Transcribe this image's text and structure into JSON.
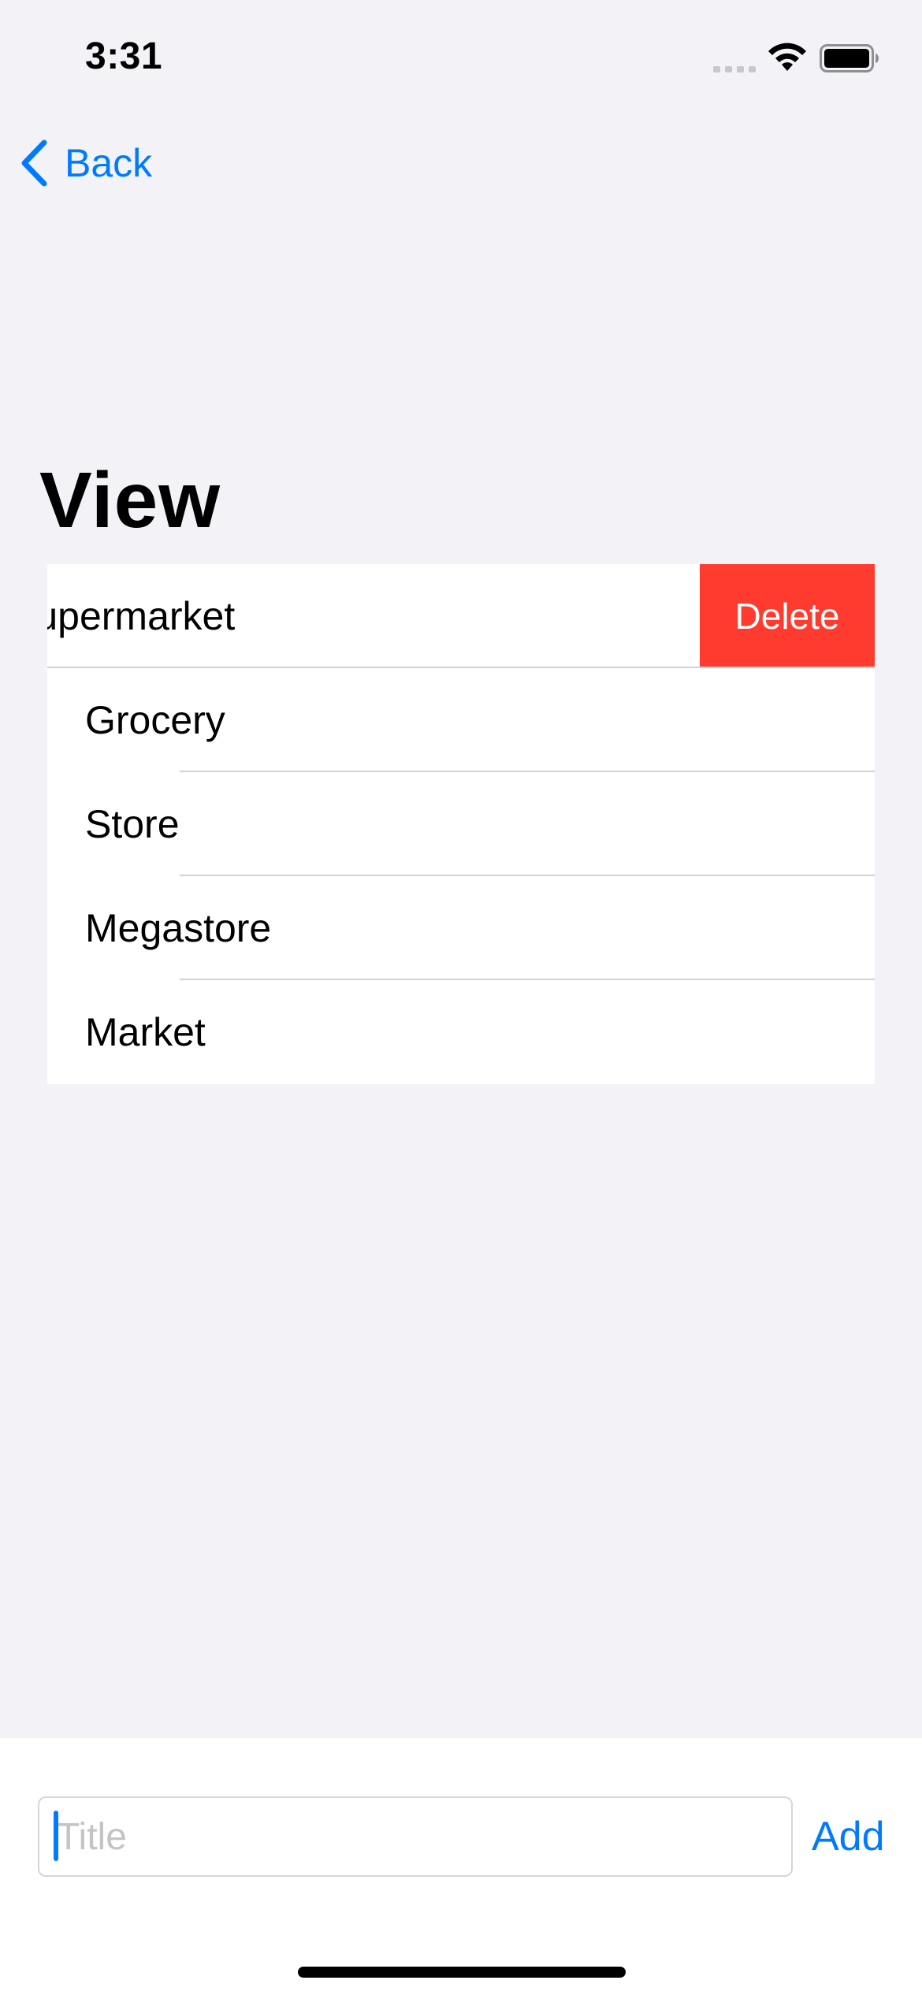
{
  "status_bar": {
    "time": "3:31",
    "icons": [
      "signal-icon",
      "wifi-icon",
      "battery-icon"
    ]
  },
  "nav": {
    "back_label": "Back",
    "back_icon": "chevron-left-icon"
  },
  "page": {
    "title": "View"
  },
  "list": {
    "swiped_item": {
      "label": "Supermarket",
      "delete_label": "Delete"
    },
    "items": [
      {
        "label": "Grocery"
      },
      {
        "label": "Store"
      },
      {
        "label": "Megastore"
      },
      {
        "label": "Market"
      }
    ]
  },
  "bottom_bar": {
    "input_placeholder": "Title",
    "input_value": "",
    "add_label": "Add"
  },
  "colors": {
    "accent": "#007aff",
    "destructive": "#ff3b30",
    "background": "#f2f2f7"
  }
}
